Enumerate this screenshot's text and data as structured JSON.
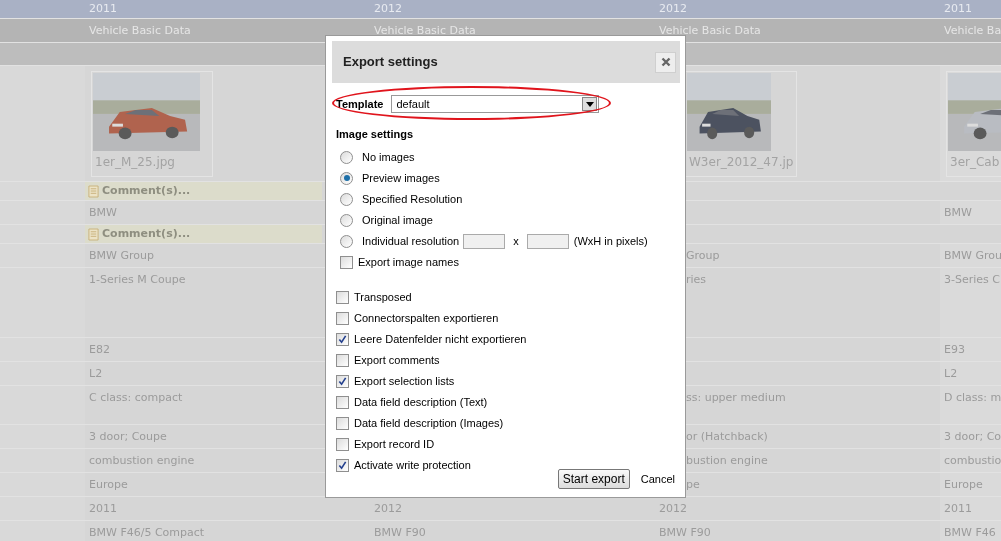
{
  "table": {
    "rows": [
      {
        "kind": "header",
        "column_1": "2011",
        "column_2": "2012",
        "column_3": "2012",
        "column_4": "2011"
      },
      {
        "kind": "section",
        "column_1": "Vehicle Basic Data",
        "column_2": "Vehicle Basic Data",
        "column_3": "Vehicle Basic Data",
        "column_4": "Vehicle Ba"
      },
      {
        "kind": "blank"
      },
      {
        "kind": "images",
        "column_1": "1er_M_25.jpg",
        "column_3": "W3er_2012_47.jp",
        "column_4": "3er_Cab"
      },
      {
        "kind": "comment",
        "column_1": "Comment(s)..."
      },
      {
        "kind": "data",
        "column_1": "BMW",
        "column_4": "BMW"
      },
      {
        "kind": "comment",
        "column_1": "Comment(s)..."
      },
      {
        "kind": "data",
        "column_1": "BMW Group",
        "column_3": "Group",
        "column_4": "BMW Grou"
      },
      {
        "kind": "tall",
        "column_1": "1-Series M Coupe",
        "column_3": "ries",
        "column_4": "3-Series C"
      },
      {
        "kind": "data",
        "column_1": "E82",
        "column_4": "E93"
      },
      {
        "kind": "data",
        "column_1": "L2",
        "column_4": "L2"
      },
      {
        "kind": "medium",
        "column_1": "C class: compact",
        "column_3": "ss: upper medium",
        "column_4": "D class: m"
      },
      {
        "kind": "data",
        "column_1": "3 door; Coupe",
        "column_3": "or (Hatchback)",
        "column_4": "3 door; Co"
      },
      {
        "kind": "data",
        "column_1": "combustion engine",
        "column_3": "bustion engine",
        "column_4": "combustio"
      },
      {
        "kind": "data",
        "column_1": "Europe",
        "column_3": "pe",
        "column_4": "Europe"
      },
      {
        "kind": "data",
        "column_1": "2011",
        "column_2": "2012",
        "column_3": "2012",
        "column_4": "2011"
      },
      {
        "kind": "data",
        "column_1": "BMW F46/5 Compact",
        "column_2": "BMW F90",
        "column_3": "BMW F90",
        "column_4": "BMW F46"
      }
    ]
  },
  "dialog": {
    "title": "Export settings",
    "template": {
      "label": "Template",
      "value": "default",
      "highlighted": true
    },
    "image_settings": {
      "heading": "Image settings",
      "options": [
        {
          "kind": "plain",
          "label": "No images",
          "selected": false
        },
        {
          "kind": "plain",
          "label": "Preview images",
          "selected": true
        },
        {
          "kind": "plain",
          "label": "Specified Resolution",
          "selected": false
        },
        {
          "kind": "plain",
          "label": "Original image",
          "selected": false
        },
        {
          "kind": "resolution",
          "label": "Individual resolution",
          "selected": false,
          "separator": "x",
          "hint": "(WxH in pixels)"
        }
      ],
      "export_names": {
        "label": "Export image names",
        "checked": false
      }
    },
    "options": [
      {
        "label": "Transposed",
        "checked": false
      },
      {
        "label": "Connectorspalten exportieren",
        "checked": false
      },
      {
        "label": "Leere Datenfelder nicht exportieren",
        "checked": true
      },
      {
        "label": "Export comments",
        "checked": false
      },
      {
        "label": "Export selection lists",
        "checked": true
      },
      {
        "label": "Data field description (Text)",
        "checked": false
      },
      {
        "label": "Data field description (Images)",
        "checked": false
      },
      {
        "label": "Export record ID",
        "checked": false
      },
      {
        "label": "Activate write protection",
        "checked": true
      }
    ],
    "buttons": {
      "start": "Start export",
      "cancel": "Cancel"
    }
  }
}
